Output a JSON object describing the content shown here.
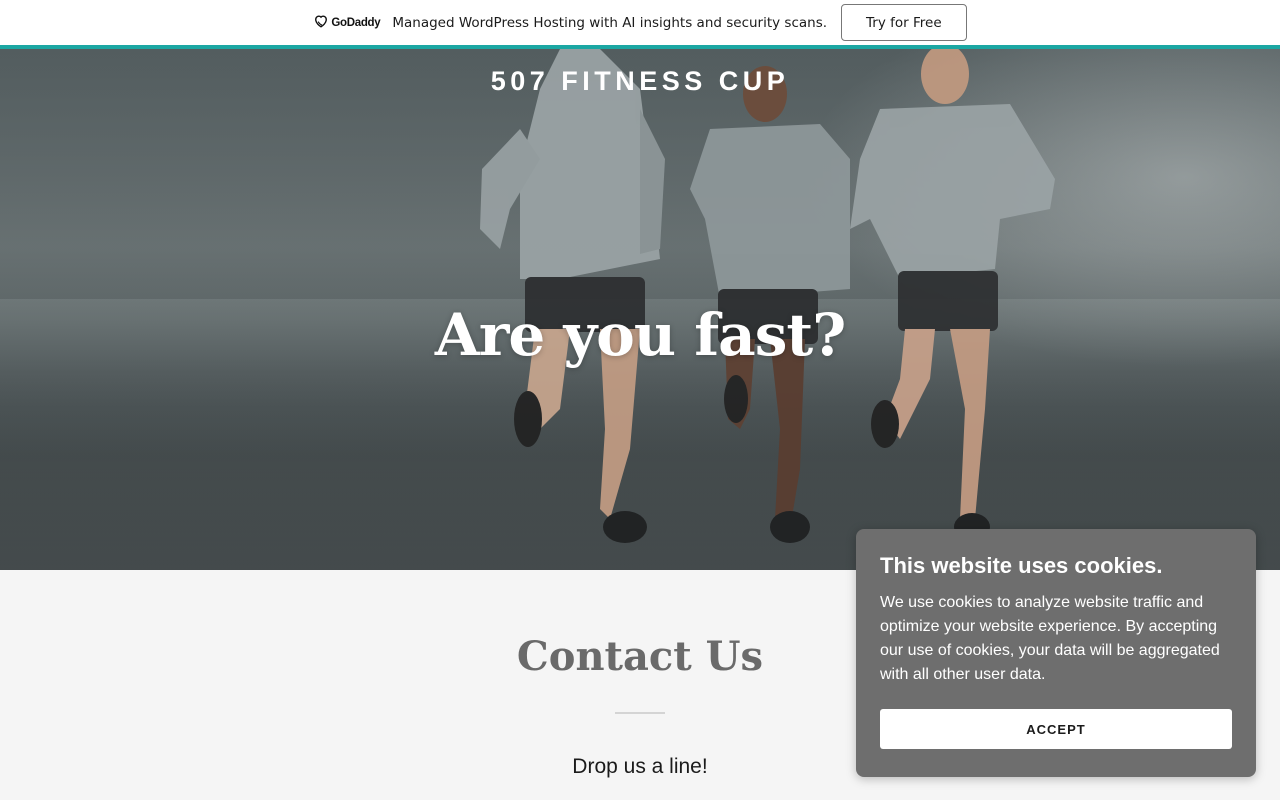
{
  "promo": {
    "logo_text": "GoDaddy",
    "message": "Managed WordPress Hosting with AI insights and security scans.",
    "cta_label": "Try for Free",
    "stripe_color": "#1ba7a3"
  },
  "hero": {
    "site_title": "507 FITNESS CUP",
    "heading": "Are you fast?"
  },
  "contact": {
    "title": "Contact Us",
    "subtitle": "Drop us a line!"
  },
  "cookie_dialog": {
    "title": "This website uses cookies.",
    "body": "We use cookies to analyze website traffic and optimize your website experience. By accepting our use of cookies, your data will be aggregated with all other user data.",
    "accept_label": "ACCEPT",
    "background_color": "#6e6e6e"
  },
  "icons": {
    "brand_logo": "godaddy-logo-icon"
  }
}
